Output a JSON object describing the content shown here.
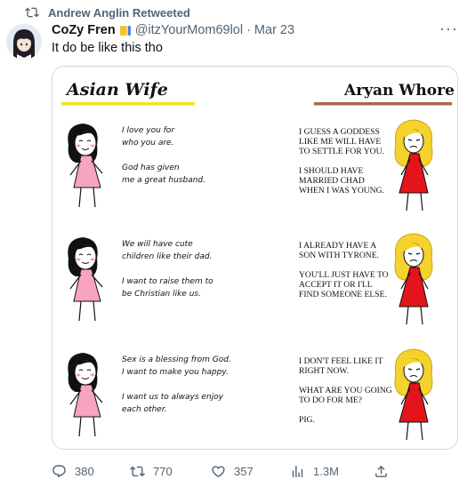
{
  "retweet": {
    "label": "Andrew Anglin Retweeted"
  },
  "author": {
    "display_name": "CoZy Fren",
    "handle": "@itzYourMom69lol",
    "separator": "·",
    "date": "Mar 23"
  },
  "tweet": {
    "text": "It do be like this tho"
  },
  "comic": {
    "left_title": "Asian Wife",
    "right_title": "Aryan Whore",
    "left_color": "#f2e31d",
    "right_color": "#a8694c",
    "panels": [
      {
        "left": [
          "I love you for",
          "who you are.",
          "",
          "God has given",
          "me a great husband."
        ],
        "right": [
          "I GUESS A GODDESS",
          "LIKE ME WILL HAVE",
          "TO SETTLE FOR YOU.",
          "",
          "I SHOULD HAVE",
          "MARRIED CHAD",
          "WHEN I WAS YOUNG."
        ]
      },
      {
        "left": [
          "We will have cute",
          "children like their dad.",
          "",
          "I want to raise them to",
          "be Christian like us."
        ],
        "right": [
          "I ALREADY HAVE A",
          "SON WITH TYRONE.",
          "",
          "YOU'LL JUST HAVE TO",
          "ACCEPT IT OR I'LL",
          "FIND SOMEONE ELSE."
        ]
      },
      {
        "left": [
          "Sex is a blessing from God.",
          "I want to make you happy.",
          "",
          "I want us to always enjoy",
          "each other."
        ],
        "right": [
          "I DON'T FEEL LIKE IT",
          "RIGHT NOW.",
          "",
          "WHAT ARE YOU GOING",
          "TO DO FOR ME?",
          "",
          "PIG."
        ]
      }
    ]
  },
  "actions": {
    "replies": "380",
    "retweets": "770",
    "likes": "357",
    "views": "1.3M"
  }
}
